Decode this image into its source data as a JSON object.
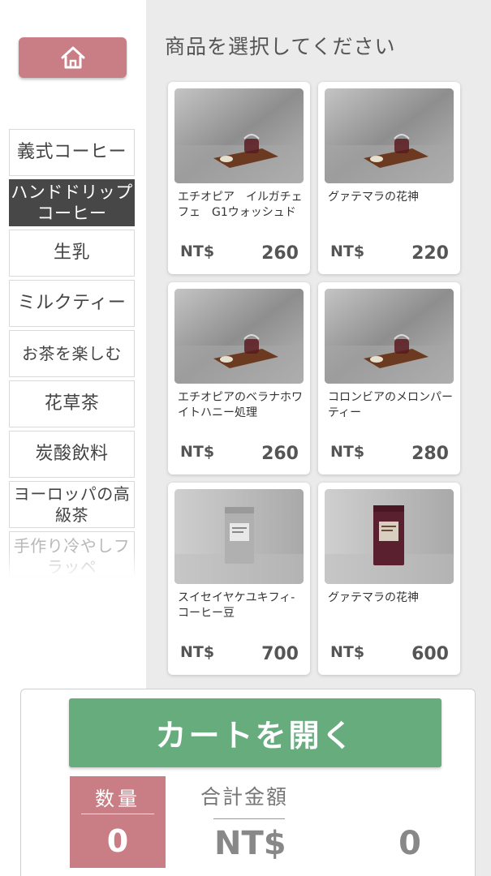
{
  "page_title": "商品を選択してください",
  "sidebar": {
    "home_icon": "home-icon",
    "categories": [
      {
        "label": "義式コーヒー",
        "active": false
      },
      {
        "label": "ハンドドリップコーヒー",
        "active": true
      },
      {
        "label": "生乳",
        "active": false
      },
      {
        "label": "ミルクティー",
        "active": false
      },
      {
        "label": "お茶を楽しむ",
        "active": false
      },
      {
        "label": "花草茶",
        "active": false
      },
      {
        "label": "炭酸飲料",
        "active": false
      },
      {
        "label": "ヨーロッパの高級茶",
        "active": false
      },
      {
        "label": "手作り冷やしフラッペ",
        "active": false
      }
    ]
  },
  "products": [
    {
      "name": "エチオピア　イルガチェフェ　G1ウォッシュド",
      "currency": "NT$",
      "price": "260",
      "image": "pour-over-coffee-set"
    },
    {
      "name": "グァテマラの花神",
      "currency": "NT$",
      "price": "220",
      "image": "pour-over-coffee-set"
    },
    {
      "name": "エチオピアのベラナホワイトハニー処理",
      "currency": "NT$",
      "price": "260",
      "image": "pour-over-coffee-set"
    },
    {
      "name": "コロンビアのメロンパーティー",
      "currency": "NT$",
      "price": "280",
      "image": "pour-over-coffee-set"
    },
    {
      "name": "スイセイヤケユキフィ-コーヒー豆",
      "currency": "NT$",
      "price": "700",
      "image": "silver-coffee-bag"
    },
    {
      "name": "グァテマラの花神",
      "currency": "NT$",
      "price": "600",
      "image": "burgundy-coffee-bag"
    }
  ],
  "cart": {
    "open_label": "カートを開く",
    "quantity_label": "数量",
    "quantity_value": "0",
    "total_label": "合計金額",
    "total_currency": "NT$",
    "total_value": "0"
  },
  "colors": {
    "accent_pink": "#c97d84",
    "accent_green": "#66ac7d",
    "active_category": "#474747"
  }
}
